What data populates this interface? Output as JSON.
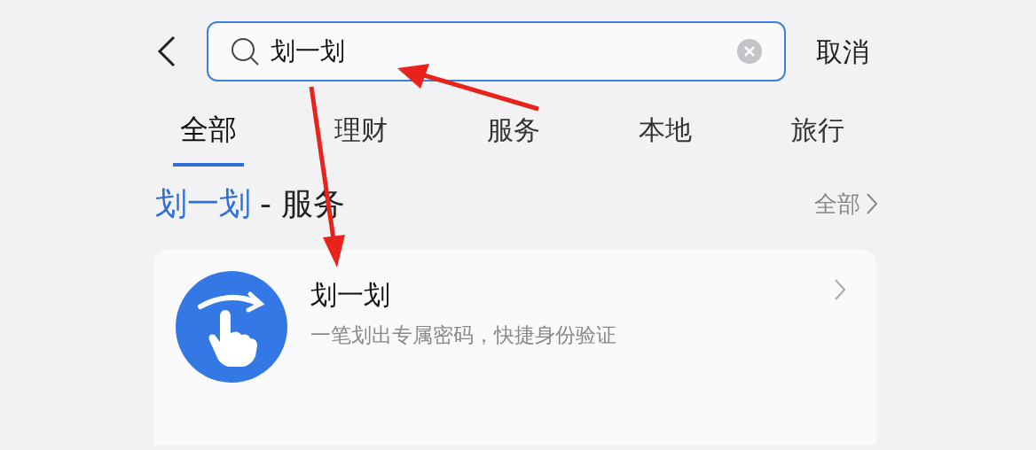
{
  "search": {
    "value": "划一划",
    "cancel": "取消"
  },
  "tabs": [
    {
      "label": "全部",
      "selected": true
    },
    {
      "label": "理财",
      "selected": false
    },
    {
      "label": "服务",
      "selected": false
    },
    {
      "label": "本地",
      "selected": false
    },
    {
      "label": "旅行",
      "selected": false
    }
  ],
  "section": {
    "title_parts": [
      {
        "text": "划一划",
        "highlight": true
      },
      {
        "text": "- 服务",
        "highlight": false
      }
    ],
    "more": "全部"
  },
  "results": [
    {
      "title": "划一划",
      "subtitle": "一笔划出专属密码，快捷身份验证"
    }
  ]
}
